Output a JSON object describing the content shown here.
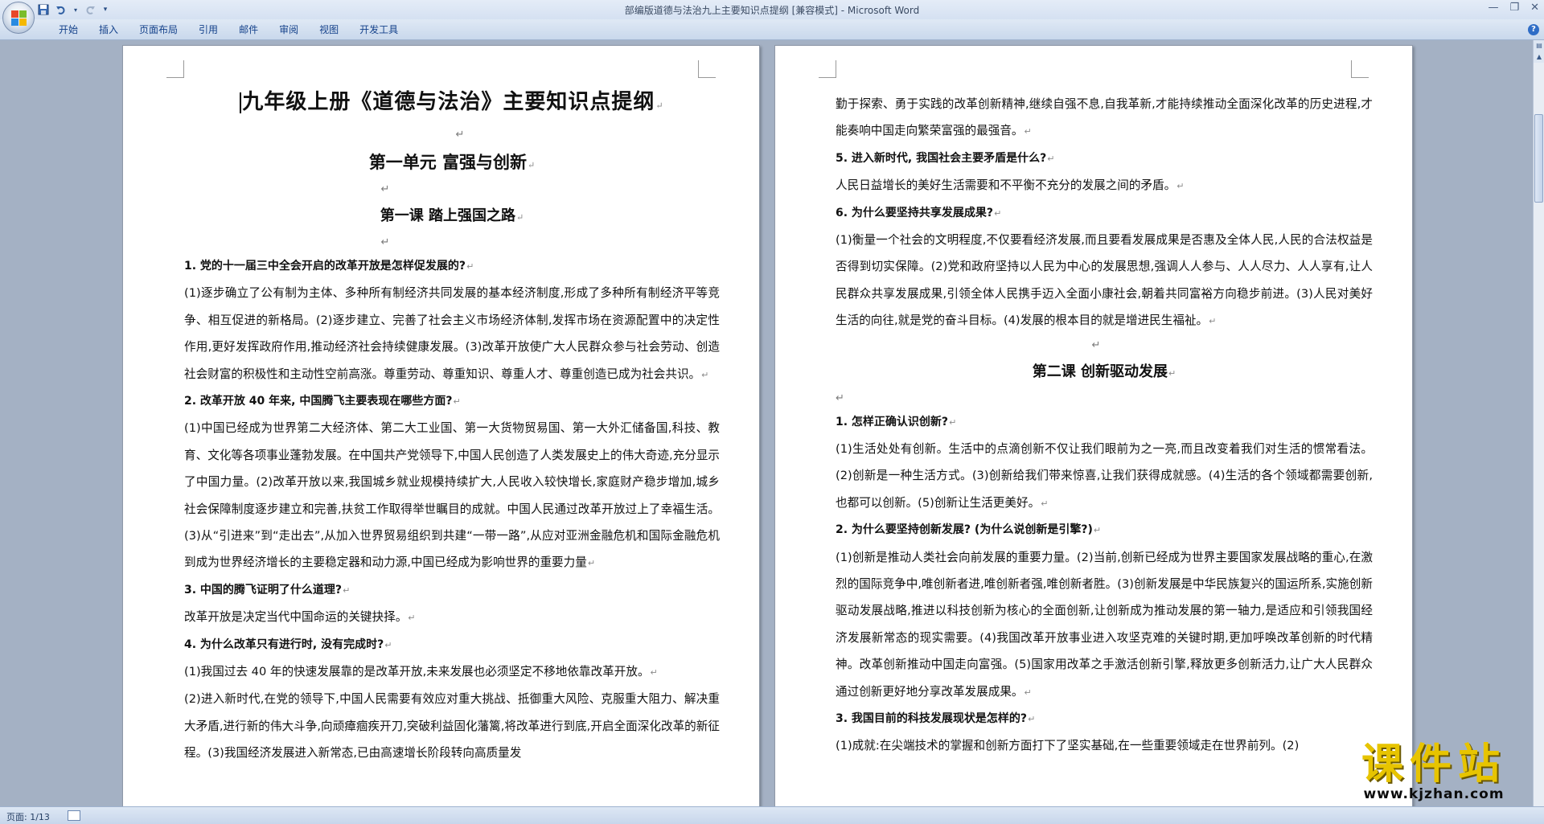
{
  "window": {
    "title": "部编版道德与法治九上主要知识点提纲 [兼容模式] - Microsoft Word"
  },
  "quick_access": {
    "icons": [
      "save-icon",
      "undo-icon",
      "redo-icon",
      "customize-icon"
    ]
  },
  "ribbon": {
    "tabs": [
      "开始",
      "插入",
      "页面布局",
      "引用",
      "邮件",
      "审阅",
      "视图",
      "开发工具"
    ],
    "help": "?"
  },
  "page_left": {
    "title": "九年级上册《道德与法治》主要知识点提纲",
    "unit": "第一单元   富强与创新",
    "lesson": "第一课   踏上强国之路",
    "q1": "1. 党的十一届三中全会开启的改革开放是怎样促发展的?",
    "a1": "(1)逐步确立了公有制为主体、多种所有制经济共同发展的基本经济制度,形成了多种所有制经济平等竞争、相互促进的新格局。(2)逐步建立、完善了社会主义市场经济体制,发挥市场在资源配置中的决定性作用,更好发挥政府作用,推动经济社会持续健康发展。(3)改革开放使广大人民群众参与社会劳动、创造社会财富的积极性和主动性空前高涨。尊重劳动、尊重知识、尊重人才、尊重创造已成为社会共识。",
    "q2": "2. 改革开放 40 年来, 中国腾飞主要表现在哪些方面?",
    "a2": "(1)中国已经成为世界第二大经济体、第二大工业国、第一大货物贸易国、第一大外汇储备国,科技、教育、文化等各项事业蓬勃发展。在中国共产党领导下,中国人民创造了人类发展史上的伟大奇迹,充分显示了中国力量。(2)改革开放以来,我国城乡就业规模持续扩大,人民收入较快增长,家庭财产稳步增加,城乡社会保障制度逐步建立和完善,扶贫工作取得举世瞩目的成就。中国人民通过改革开放过上了幸福生活。(3)从“引进来”到“走出去”,从加入世界贸易组织到共建“一带一路”,从应对亚洲金融危机和国际金融危机到成为世界经济增长的主要稳定器和动力源,中国已经成为影响世界的重要力量",
    "q3": "3. 中国的腾飞证明了什么道理?",
    "a3": "改革开放是决定当代中国命运的关键抉择。",
    "q4": "4. 为什么改革只有进行时, 没有完成时?",
    "a4a": "(1)我国过去 40 年的快速发展靠的是改革开放,未来发展也必须坚定不移地依靠改革开放。",
    "a4b": "(2)进入新时代,在党的领导下,中国人民需要有效应对重大挑战、抵御重大风险、克服重大阻力、解决重大矛盾,进行新的伟大斗争,向顽瘴痼疾开刀,突破利益固化藩篱,将改革进行到底,开启全面深化改革的新征程。(3)我国经济发展进入新常态,已由高速增长阶段转向高质量发"
  },
  "page_right": {
    "cont": "勤于探索、勇于实践的改革创新精神,继续自强不息,自我革新,才能持续推动全面深化改革的历史进程,才能奏响中国走向繁荣富强的最强音。",
    "q5": "5. 进入新时代, 我国社会主要矛盾是什么?",
    "a5": "人民日益增长的美好生活需要和不平衡不充分的发展之间的矛盾。",
    "q6": "6. 为什么要坚持共享发展成果?",
    "a6": "(1)衡量一个社会的文明程度,不仅要看经济发展,而且要看发展成果是否惠及全体人民,人民的合法权益是否得到切实保障。(2)党和政府坚持以人民为中心的发展思想,强调人人参与、人人尽力、人人享有,让人民群众共享发展成果,引领全体人民携手迈入全面小康社会,朝着共同富裕方向稳步前进。(3)人民对美好生活的向往,就是党的奋斗目标。(4)发展的根本目的就是增进民生福祉。",
    "lesson2": "第二课 创新驱动发展",
    "q1": "1. 怎样正确认识创新?",
    "a1": "(1)生活处处有创新。生活中的点滴创新不仅让我们眼前为之一亮,而且改变着我们对生活的惯常看法。(2)创新是一种生活方式。(3)创新给我们带来惊喜,让我们获得成就感。(4)生活的各个领域都需要创新,也都可以创新。(5)创新让生活更美好。",
    "q2": "2. 为什么要坚持创新发展? (为什么说创新是引擎?)",
    "a2": "(1)创新是推动人类社会向前发展的重要力量。(2)当前,创新已经成为世界主要国家发展战略的重心,在激烈的国际竞争中,唯创新者进,唯创新者强,唯创新者胜。(3)创新发展是中华民族复兴的国运所系,实施创新驱动发展战略,推进以科技创新为核心的全面创新,让创新成为推动发展的第一轴力,是适应和引领我国经济发展新常态的现实需要。(4)我国改革开放事业进入攻坚克难的关键时期,更加呼唤改革创新的时代精神。改革创新推动中国走向富强。(5)国家用改革之手激活创新引擎,释放更多创新活力,让广大人民群众通过创新更好地分享改革发展成果。",
    "q3": "3. 我国目前的科技发展现状是怎样的?",
    "a3": "(1)成就:在尖端技术的掌握和创新方面打下了坚实基础,在一些重要领域走在世界前列。(2)"
  },
  "statusbar": {
    "page": "页面: 1/13"
  },
  "watermark": {
    "main": "课件站",
    "url": "www.kjzhan.com"
  },
  "colors": {
    "ribbon_text": "#15428b",
    "workspace": "#a4b1c4",
    "watermark": "#e7c400"
  }
}
